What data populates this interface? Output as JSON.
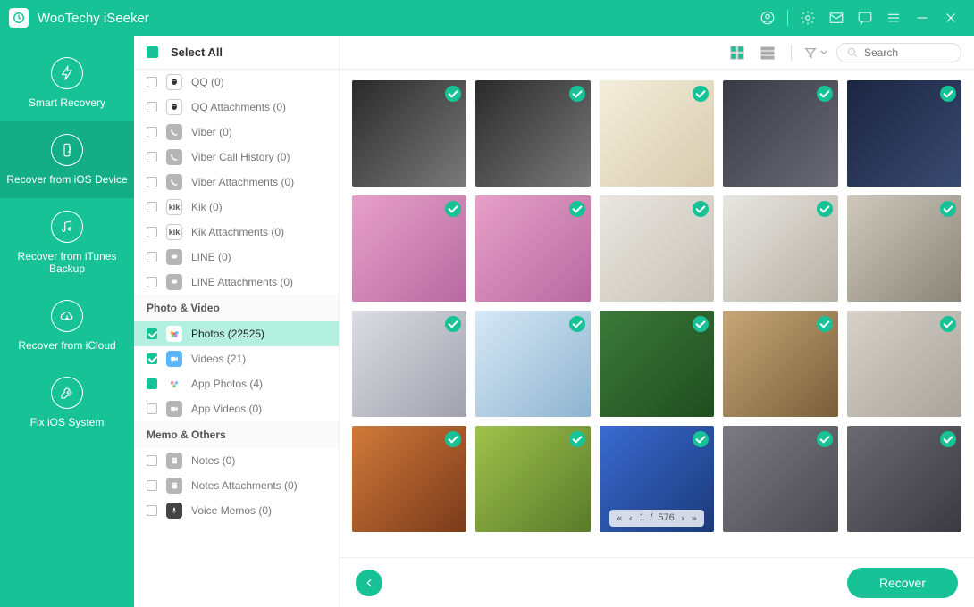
{
  "app": {
    "title": "WooTechy iSeeker"
  },
  "sidebar": {
    "items": [
      {
        "label": "Smart Recovery"
      },
      {
        "label": "Recover from iOS Device"
      },
      {
        "label": "Recover from iTunes Backup"
      },
      {
        "label": "Recover from iCloud"
      },
      {
        "label": "Fix iOS System"
      }
    ]
  },
  "filelist": {
    "select_all": "Select All",
    "groups": [
      {
        "name": "messaging_tail",
        "items": [
          {
            "label": "QQ (0)",
            "icon": "qq"
          },
          {
            "label": "QQ Attachments (0)",
            "icon": "qq"
          },
          {
            "label": "Viber (0)",
            "icon": "viber"
          },
          {
            "label": "Viber Call History (0)",
            "icon": "viber"
          },
          {
            "label": "Viber Attachments (0)",
            "icon": "viber"
          },
          {
            "label": "Kik (0)",
            "icon": "kik"
          },
          {
            "label": "Kik Attachments (0)",
            "icon": "kik"
          },
          {
            "label": "LINE (0)",
            "icon": "line"
          },
          {
            "label": "LINE Attachments (0)",
            "icon": "line"
          }
        ]
      },
      {
        "name": "Photo & Video",
        "items": [
          {
            "label": "Photos (22525)",
            "icon": "photos",
            "checked": true,
            "selected": true
          },
          {
            "label": "Videos (21)",
            "icon": "videos",
            "checked": true
          },
          {
            "label": "App Photos (4)",
            "icon": "appphotos",
            "partial": true
          },
          {
            "label": "App Videos (0)",
            "icon": "appvideos"
          }
        ]
      },
      {
        "name": "Memo & Others",
        "items": [
          {
            "label": "Notes (0)",
            "icon": "notes"
          },
          {
            "label": "Notes Attachments (0)",
            "icon": "notes"
          },
          {
            "label": "Voice Memos (0)",
            "icon": "voice"
          }
        ]
      }
    ]
  },
  "toolbar": {
    "search_placeholder": "Search"
  },
  "paging": {
    "current": "1",
    "sep": "/",
    "total": "576"
  },
  "actions": {
    "recover": "Recover"
  },
  "thumbnails": [
    {
      "c1": "#2a2a2a",
      "c2": "#7a7a7a"
    },
    {
      "c1": "#2a2a2a",
      "c2": "#7a7a7a"
    },
    {
      "c1": "#f3eedb",
      "c2": "#d8caae"
    },
    {
      "c1": "#3a3a44",
      "c2": "#6a6a77"
    },
    {
      "c1": "#1a2540",
      "c2": "#3a4a70"
    },
    {
      "c1": "#e7a0c8",
      "c2": "#b66aa0"
    },
    {
      "c1": "#e7a0c8",
      "c2": "#b66aa0"
    },
    {
      "c1": "#e9e6e0",
      "c2": "#c7c2b7"
    },
    {
      "c1": "#e8e6e1",
      "c2": "#b6b0a4"
    },
    {
      "c1": "#cfc9bd",
      "c2": "#8a8578"
    },
    {
      "c1": "#dcdde2",
      "c2": "#9fa2ad"
    },
    {
      "c1": "#d6e8f5",
      "c2": "#8fb4d0"
    },
    {
      "c1": "#3c7a3a",
      "c2": "#1f4d1f"
    },
    {
      "c1": "#c6a877",
      "c2": "#7a5e3a"
    },
    {
      "c1": "#d6d2c9",
      "c2": "#a9a49a"
    },
    {
      "c1": "#d07a3a",
      "c2": "#7a3a1a"
    },
    {
      "c1": "#9fc24b",
      "c2": "#5a7a2b"
    },
    {
      "c1": "#3a6ad0",
      "c2": "#1a3a7a"
    },
    {
      "c1": "#7a7a80",
      "c2": "#4a4a50"
    },
    {
      "c1": "#6a6a70",
      "c2": "#3a3a40"
    }
  ]
}
